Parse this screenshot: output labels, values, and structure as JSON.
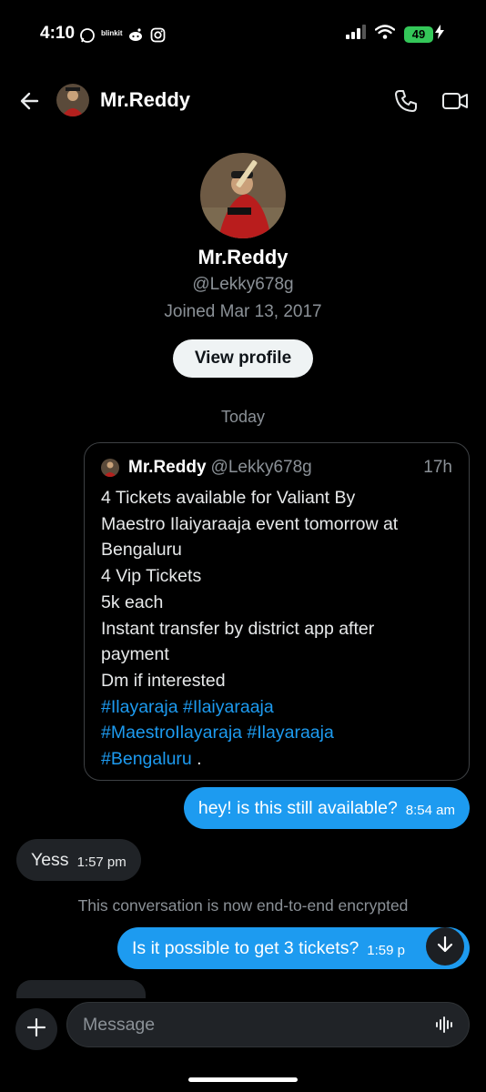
{
  "status_bar": {
    "time": "4:10",
    "app_label": "blinkit",
    "battery": "49"
  },
  "header": {
    "name": "Mr.Reddy"
  },
  "profile": {
    "name": "Mr.Reddy",
    "handle": "@Lekky678g",
    "joined": "Joined Mar 13, 2017",
    "view_profile_label": "View profile"
  },
  "date_separator": "Today",
  "quoted_tweet": {
    "name": "Mr.Reddy",
    "handle": "@Lekky678g",
    "time": "17h",
    "lines": [
      "4 Tickets available for Valiant By",
      "Maestro Ilaiyaraaja event tomorrow at",
      "Bengaluru",
      "4 Vip Tickets",
      "5k each",
      "Instant transfer by district app after",
      "payment",
      "Dm if interested"
    ],
    "hashtags": {
      "h1": "#Ilayaraja",
      "h2": "#Ilaiyaraaja",
      "h3": "#MaestroIlayaraja",
      "h4": "#Ilayaraaja",
      "h5": "#Bengaluru",
      "end": " ."
    }
  },
  "messages": [
    {
      "direction": "outgoing",
      "text": "hey! is this still available?",
      "time": "8:54 am"
    },
    {
      "direction": "incoming",
      "text": "Yess",
      "time": "1:57 pm"
    },
    {
      "direction": "outgoing",
      "text": "Is it possible to get 3 tickets?",
      "time": "1:59 p"
    }
  ],
  "encryption_notice": "This conversation is now end-to-end encrypted",
  "composer": {
    "placeholder": "Message"
  },
  "colors": {
    "accent": "#1d9bf0",
    "background": "#000000",
    "incoming_bubble": "#202327",
    "battery": "#34c759"
  },
  "icons": {
    "back": "arrow-left-icon",
    "call": "phone-icon",
    "video": "video-camera-icon",
    "add": "plus-icon",
    "voice": "waveform-icon",
    "scroll": "arrow-down-icon"
  }
}
